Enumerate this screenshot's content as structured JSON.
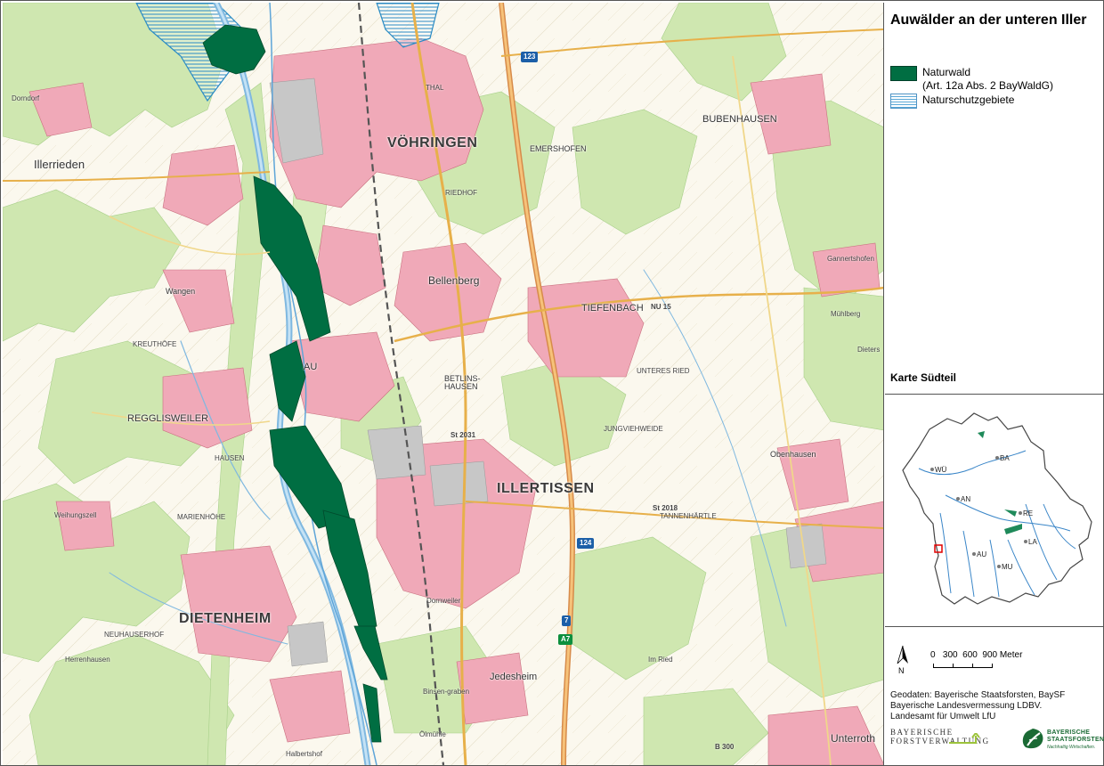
{
  "legend": {
    "title": "Auwälder an der unteren Iller",
    "items": [
      {
        "type": "naturwald",
        "label_line1": "Naturwald",
        "label_line2": "(Art. 12a Abs. 2 BayWaldG)",
        "color": "#006e42"
      },
      {
        "type": "nsg",
        "label_line1": "Naturschutzgebiete",
        "color": "#5aa7d6"
      }
    ],
    "sheet": "Karte Südteil"
  },
  "inset": {
    "cities": [
      "WÜ",
      "BA",
      "AN",
      "RE",
      "LA",
      "AU",
      "MU"
    ],
    "outline_color": "#444444",
    "river_color": "#3a86c8",
    "marker_color": "#e00000"
  },
  "scale": {
    "north_label": "N",
    "ticks_text": "0   300  600  900 Meter"
  },
  "credits": {
    "line1": "Geodaten: Bayerische Staatsforsten, BaySF",
    "line2": "Bayerische Landesvermessung LDBV.",
    "line3": "Landesamt für Umwelt LfU"
  },
  "logos": {
    "bf_line1": "BAYERISCHE",
    "bf_line2": "FORSTVERWALTUNG",
    "baysf_line1": "BAYERISCHE",
    "baysf_line2": "STAATSFORSTEN",
    "baysf_sub": "Nachhaltig Wirtschaften."
  },
  "map": {
    "towns_big": [
      "VÖHRINGEN",
      "ILLERTISSEN",
      "DIETENHEIM"
    ],
    "towns_mid": [
      "Illerrieden",
      "Bellenberg",
      "TIEFENBACH",
      "REGGLISWEILER",
      "BETLINS-HAUSEN",
      "Jedesheim",
      "BUBENHAUSEN",
      "Obenhausen",
      "Unterroth",
      "Wangen",
      "AU",
      "EMERSHOFEN"
    ],
    "towns_small": [
      "Dorndorf",
      "KREUTHÖFE",
      "Weihungszell",
      "Herrenhausen",
      "JUNGVIEHWEIDE",
      "UNTERES RIED",
      "TANNENHÄRTLE",
      "HAUSEN",
      "THAL",
      "RIEDHOF",
      "Gannertshofen",
      "Mühlberg",
      "Dieters",
      "Im Ried",
      "Halbertshof",
      "Ölmühle",
      "Dornweiler",
      "Binsen-graben",
      "NEUHAUSERHOF",
      "MARIENHÖHE"
    ],
    "roads": [
      "123",
      "124",
      "7",
      "A7",
      "NU 15",
      "St 2018",
      "St 2031",
      "B 300"
    ],
    "colors": {
      "settlement": "#f0a9b8",
      "forest": "#cfe7b0",
      "water": "#9ccbe8",
      "naturwald": "#006e42",
      "nsg": "#5aa7d6"
    }
  }
}
